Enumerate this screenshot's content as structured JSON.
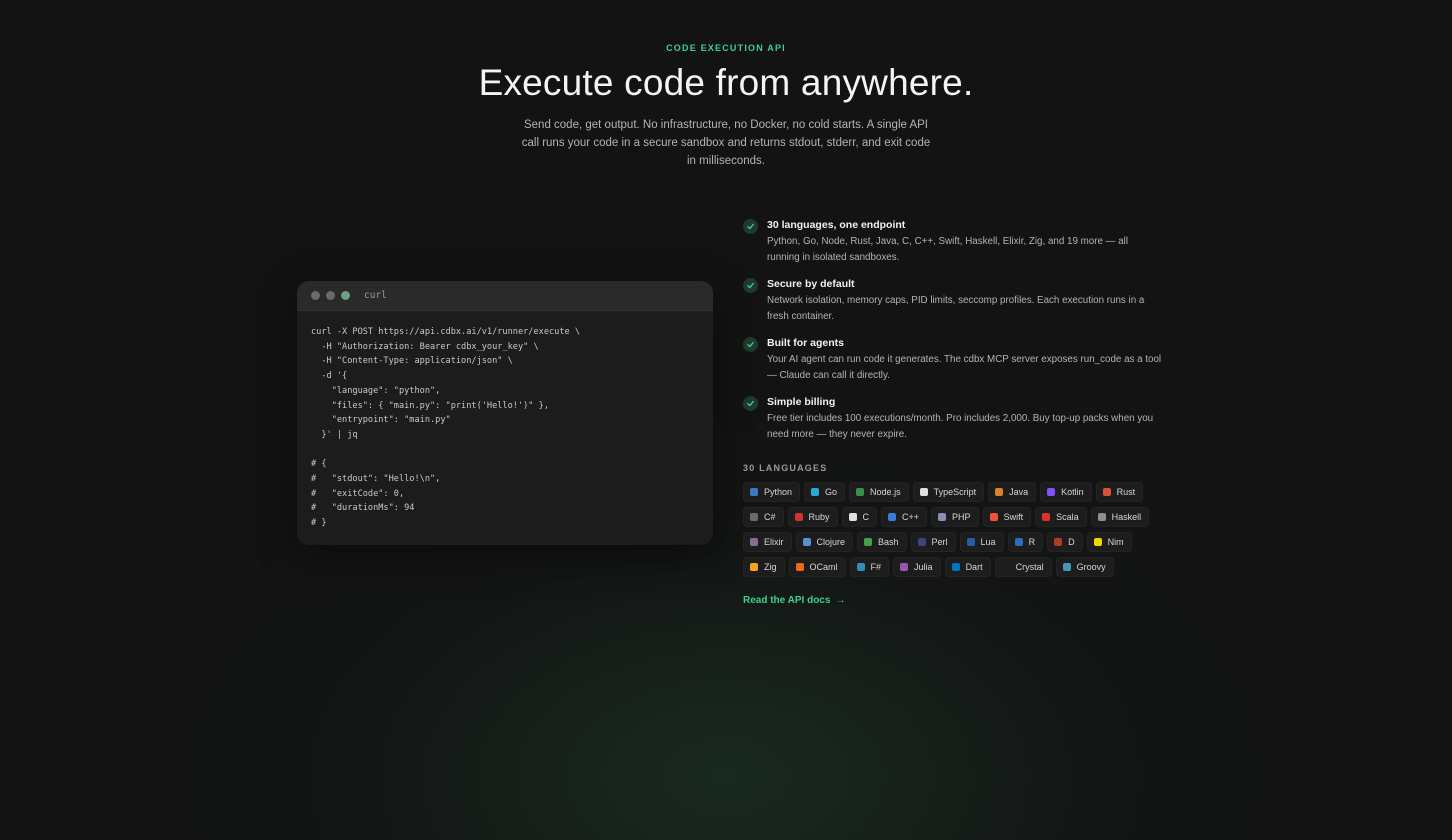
{
  "hero": {
    "eyebrow": "CODE EXECUTION API",
    "title": "Execute code from anywhere.",
    "subtitle": "Send code, get output. No infrastructure, no Docker, no cold starts. A single API call runs your code in a secure sandbox and returns stdout, stderr, and exit code in milliseconds."
  },
  "code_card": {
    "tab_label": "curl",
    "code": "curl -X POST https://api.cdbx.ai/v1/runner/execute \\\n  -H \"Authorization: Bearer cdbx_your_key\" \\\n  -H \"Content-Type: application/json\" \\\n  -d '{\n    \"language\": \"python\",\n    \"files\": { \"main.py\": \"print('Hello!')\" },\n    \"entrypoint\": \"main.py\"\n  }' | jq\n\n# {\n#   \"stdout\": \"Hello!\\n\",\n#   \"exitCode\": 0,\n#   \"durationMs\": 94\n# }"
  },
  "features": [
    {
      "title": "30 languages, one endpoint",
      "desc": "Python, Go, Node, Rust, Java, C, C++, Swift, Haskell, Elixir, Zig, and 19 more — all running in isolated sandboxes."
    },
    {
      "title": "Secure by default",
      "desc": "Network isolation, memory caps, PID limits, seccomp profiles. Each execution runs in a fresh container."
    },
    {
      "title": "Built for agents",
      "desc": "Your AI agent can run code it generates. The cdbx MCP server exposes run_code as a tool — Claude can call it directly."
    },
    {
      "title": "Simple billing",
      "desc": "Free tier includes 100 executions/month. Pro includes 2,000. Buy top-up packs when you need more — they never expire."
    }
  ],
  "languages": {
    "heading": "30 LANGUAGES",
    "items": [
      {
        "name": "Python",
        "color": "#3b78c2"
      },
      {
        "name": "Go",
        "color": "#29a9d6"
      },
      {
        "name": "Node.js",
        "color": "#3c8f4a"
      },
      {
        "name": "TypeScript",
        "color": "#e0e0e0"
      },
      {
        "name": "Java",
        "color": "#d9822b"
      },
      {
        "name": "Kotlin",
        "color": "#7f52ff"
      },
      {
        "name": "Rust",
        "color": "#d9533b"
      },
      {
        "name": "C#",
        "color": "#6b6b6b"
      },
      {
        "name": "Ruby",
        "color": "#cc342d"
      },
      {
        "name": "C",
        "color": "#e0e0e0"
      },
      {
        "name": "C++",
        "color": "#3c7bd6"
      },
      {
        "name": "PHP",
        "color": "#8a8fb8"
      },
      {
        "name": "Swift",
        "color": "#f05138"
      },
      {
        "name": "Scala",
        "color": "#dc322f"
      },
      {
        "name": "Haskell",
        "color": "#8f8f8f"
      },
      {
        "name": "Elixir",
        "color": "#8a6a9a"
      },
      {
        "name": "Clojure",
        "color": "#5a8fd6"
      },
      {
        "name": "Bash",
        "color": "#3fa34d"
      },
      {
        "name": "Perl",
        "color": "#39457e"
      },
      {
        "name": "Lua",
        "color": "#2c5aa0"
      },
      {
        "name": "R",
        "color": "#2a6ebb"
      },
      {
        "name": "D",
        "color": "#b03931"
      },
      {
        "name": "Nim",
        "color": "#f3d400"
      },
      {
        "name": "Zig",
        "color": "#f7a41d"
      },
      {
        "name": "OCaml",
        "color": "#ee6a1a"
      },
      {
        "name": "F#",
        "color": "#378bba"
      },
      {
        "name": "Julia",
        "color": "#9558b2"
      },
      {
        "name": "Dart",
        "color": "#0175c2"
      },
      {
        "name": "Crystal",
        "color": "#1d1d1d"
      },
      {
        "name": "Groovy",
        "color": "#4298b8"
      }
    ]
  },
  "docs_link": {
    "label": "Read the API docs",
    "arrow": "→"
  },
  "colors": {
    "accent": "#3fcf8e",
    "background": "#131313",
    "card": "#1c1c1c"
  }
}
